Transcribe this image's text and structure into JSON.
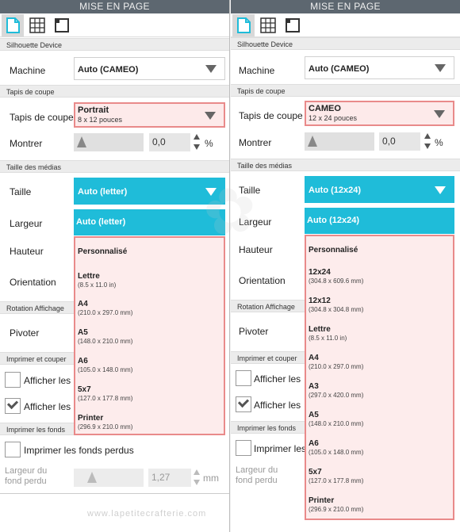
{
  "left": {
    "title": "MISE EN PAGE",
    "sections": {
      "device": "Silhouette Device",
      "mat": "Tapis de coupe",
      "media": "Taille des médias",
      "rotate": "Rotation Affichage",
      "print_cut": "Imprimer et couper",
      "bleed": "Imprimer les fonds"
    },
    "machine_label": "Machine",
    "machine_value": "Auto (CAMEO)",
    "mat_label": "Tapis de coupe",
    "mat_value": "Portrait",
    "mat_sub": "8 x 12 pouces",
    "show_label": "Montrer",
    "show_value": "0,0",
    "show_unit": "%",
    "size_label": "Taille",
    "size_value": "Auto (letter)",
    "size_highlight": "Auto (letter)",
    "width_label": "Largeur",
    "height_label": "Hauteur",
    "orientation_label": "Orientation",
    "rotate_label": "Pivoter",
    "show_reg_1": "Afficher les",
    "show_reg_2": "Afficher les",
    "bleed_label": "Imprimer les fonds perdus",
    "bleed_width_label_1": "Largeur du",
    "bleed_width_label_2": "fond perdu",
    "bleed_value": "1,27",
    "bleed_unit": "mm",
    "options": [
      {
        "title": "Personnalisé",
        "sub": ""
      },
      {
        "title": "Lettre",
        "sub": "(8.5 x 11.0 in)"
      },
      {
        "title": "A4",
        "sub": "(210.0 x 297.0 mm)"
      },
      {
        "title": "A5",
        "sub": "(148.0 x 210.0 mm)"
      },
      {
        "title": "A6",
        "sub": "(105.0 x 148.0 mm)"
      },
      {
        "title": "5x7",
        "sub": "(127.0 x 177.8 mm)"
      },
      {
        "title": "Printer",
        "sub": "(296.9 x 210.0 mm)"
      }
    ]
  },
  "right": {
    "title": "MISE EN PAGE",
    "sections": {
      "device": "Silhouette Device",
      "mat": "Tapis de coupe",
      "media": "Taille des médias",
      "rotate": "Rotation Affichage",
      "print_cut": "Imprimer et couper",
      "bleed": "Imprimer les fonds"
    },
    "machine_label": "Machine",
    "machine_value": "Auto (CAMEO)",
    "mat_label": "Tapis de coupe",
    "mat_value": "CAMEO",
    "mat_sub": "12 x 24 pouces",
    "show_label": "Montrer",
    "show_value": "0,0",
    "show_unit": "%",
    "size_label": "Taille",
    "size_value": "Auto (12x24)",
    "size_highlight": "Auto (12x24)",
    "width_label": "Largeur",
    "height_label": "Hauteur",
    "orientation_label": "Orientation",
    "rotate_label": "Pivoter",
    "show_reg_1": "Afficher les",
    "show_reg_2": "Afficher les",
    "bleed_label": "Imprimer les",
    "bleed_width_label_1": "Largeur du",
    "bleed_width_label_2": "fond perdu",
    "options": [
      {
        "title": "Personnalisé",
        "sub": ""
      },
      {
        "title": "12x24",
        "sub": "(304.8 x 609.6 mm)"
      },
      {
        "title": "12x12",
        "sub": "(304.8 x 304.8 mm)"
      },
      {
        "title": "Lettre",
        "sub": "(8.5 x 11.0 in)"
      },
      {
        "title": "A4",
        "sub": "(210.0 x 297.0 mm)"
      },
      {
        "title": "A3",
        "sub": "(297.0 x 420.0 mm)"
      },
      {
        "title": "A5",
        "sub": "(148.0 x 210.0 mm)"
      },
      {
        "title": "A6",
        "sub": "(105.0 x 148.0 mm)"
      },
      {
        "title": "5x7",
        "sub": "(127.0 x 177.8 mm)"
      },
      {
        "title": "Printer",
        "sub": "(296.9 x 210.0 mm)"
      }
    ]
  },
  "footer_url": "www.lapetitecrafterie.com",
  "colors": {
    "accent": "#1fbcd9",
    "highlight_border": "#e98a8a",
    "highlight_bg": "#fdecec",
    "titlebar": "#5d6770"
  }
}
